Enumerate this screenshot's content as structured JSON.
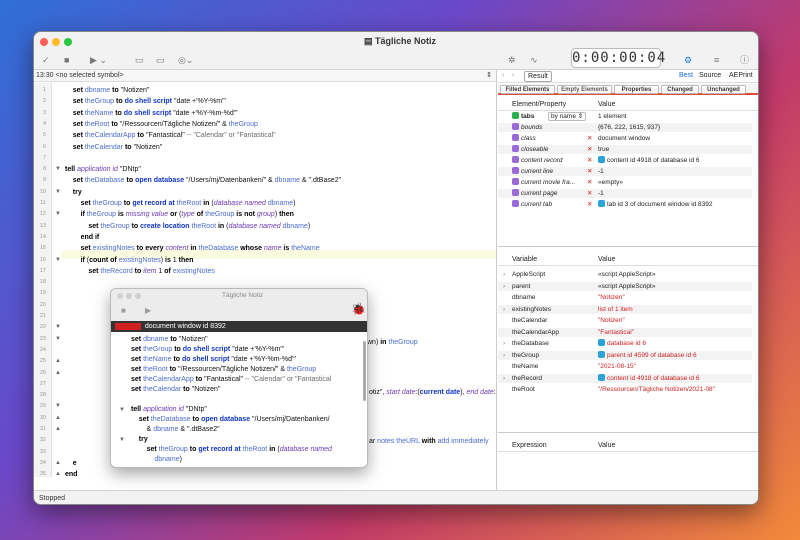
{
  "window": {
    "title": "Tägliche Notiz",
    "timer": "0:00:00:04"
  },
  "toolbar_right": {
    "best": "Best",
    "source": "Source",
    "aeprint": "AEPrint",
    "result_btn": "Result"
  },
  "navbar": {
    "position": "13:30",
    "symbol": "<no selected symbol>"
  },
  "status": "Stopped",
  "code_lines": [
    {
      "n": "1",
      "t": "    <span class='k'>set</span> <span class='c'>dbname</span> <span class='k'>to</span> \"Notizen\""
    },
    {
      "n": "2",
      "t": "    <span class='k'>set</span> <span class='c'>theGroup</span> <span class='k'>to</span> <span class='b'>do shell script</span> \"date +'%Y-%m'\""
    },
    {
      "n": "3",
      "t": "    <span class='k'>set</span> <span class='c'>theName</span> <span class='k'>to</span> <span class='b'>do shell script</span> \"date +'%Y-%m-%d'\""
    },
    {
      "n": "4",
      "t": "    <span class='k'>set</span> <span class='c'>theRoot</span> <span class='k'>to</span> \"/Ressourcen/Tägliche Notizen/\" &amp; <span class='c'>theGroup</span>"
    },
    {
      "n": "5",
      "t": "    <span class='k'>set</span> <span class='c'>theCalendarApp</span> <span class='k'>to</span> \"Fantastical\" <span class='g'>-- \"Calendar\" or \"Fantastical\"</span>"
    },
    {
      "n": "6",
      "t": "    <span class='k'>set</span> <span class='c'>theCalendar</span> <span class='k'>to</span> \"Notizen\""
    },
    {
      "n": "7",
      "t": ""
    },
    {
      "n": "8",
      "t": "<span class='k'>tell</span> <span class='i'>application id</span> \"DNtp\""
    },
    {
      "n": "9",
      "t": "    <span class='k'>set</span> <span class='c'>theDatabase</span> <span class='k'>to</span> <span class='b'>open database</span> \"/Users/mj/Datenbanken/\" &amp; <span class='c'>dbname</span> &amp; \".dtBase2\""
    },
    {
      "n": "10",
      "t": "    <span class='k'>try</span>"
    },
    {
      "n": "11",
      "t": "        <span class='k'>set</span> <span class='c'>theGroup</span> <span class='k'>to</span> <span class='b'>get record at</span> <span class='c'>theRoot</span> <span class='k'>in</span> (<span class='i'>database named</span> <span class='c'>dbname</span>)"
    },
    {
      "n": "12",
      "t": "        <span class='k'>if</span> <span class='c'>theGroup</span> <span class='k'>is</span> <span class='i'>missing value</span> <span class='k'>or</span> (<span class='i'>type</span> <span class='k'>of</span> <span class='c'>theGroup</span> <span class='k'>is not</span> <span class='i'>group</span>) <span class='k'>then</span>"
    },
    {
      "n": "13",
      "t": "            <span class='k'>set</span> <span class='c'>theGroup</span> <span class='k'>to</span> <span class='b'>create location</span> <span class='c'>theRoot</span> <span class='k'>in</span> (<span class='i'>database named</span> <span class='c'>dbname</span>)"
    },
    {
      "n": "14",
      "t": "        <span class='k'>end if</span>"
    },
    {
      "n": "15",
      "t": "        <span class='k'>set</span> <span class='c'>existingNotes</span> <span class='k'>to</span> <span class='k'>every</span> <span class='i'>content</span> <span class='k'>in</span> <span class='c'>theDatabase</span> <span class='k'>whose</span> <span class='i'>name</span> <span class='k'>is</span> <span class='c'>theName</span>"
    },
    {
      "n": "16",
      "t": "        <span class='k'>if</span> (<span class='k'>count of</span> <span class='c'>existingNotes</span>) <span class='k'>is</span> 1 <span class='k'>then</span>"
    },
    {
      "n": "17",
      "t": "            <span class='k'>set</span> <span class='c'>theRecord</span> <span class='k'>to</span> <span class='i'>item</span> 1 <span class='k'>of</span> <span class='c'>existingNotes</span>"
    },
    {
      "n": "18",
      "t": ""
    },
    {
      "n": "19",
      "t": ""
    },
    {
      "n": "20",
      "t": ""
    },
    {
      "n": "21",
      "t": ""
    },
    {
      "n": "22",
      "t": ""
    },
    {
      "n": "23",
      "t": ""
    },
    {
      "n": "24",
      "t": ""
    },
    {
      "n": "25",
      "t": ""
    },
    {
      "n": "26",
      "t": ""
    },
    {
      "n": "27",
      "t": ""
    },
    {
      "n": "28",
      "t": ""
    },
    {
      "n": "29",
      "t": ""
    },
    {
      "n": "30",
      "t": ""
    },
    {
      "n": "31",
      "t": ""
    },
    {
      "n": "32",
      "t": ""
    },
    {
      "n": "33",
      "t": ""
    },
    {
      "n": "34",
      "t": "    <span class='k'>e</span>"
    },
    {
      "n": "35",
      "t": "<span class='k'>end</span>"
    }
  ],
  "behind_fragments": {
    "a": "wn) <span class='k'>in</span> <span class='c'>theGroup</span>",
    "b": "otiz\", <span class='i'>start date</span>:(<span class='b'>current date</span>), <span class='i'>end date</span>:(",
    "c": "ar <span class='c'>notes</span> <span class='c'>theURL</span> <span class='k'>with</span> <span class='c'>add immediately</span>"
  },
  "debugger": {
    "title": "Tägliche Notiz",
    "bar_label": "document window id 8392",
    "bar_red": "Result",
    "lines": [
      "<span class='k'>set</span> <span class='c'>dbname</span> <span class='k'>to</span> \"Notizen\"",
      "<span class='k'>set</span> <span class='c'>theGroup</span> <span class='k'>to</span> <span class='b'>do shell script</span> \"date +'%Y-%m'\"",
      "<span class='k'>set</span> <span class='c'>theName</span> <span class='k'>to</span> <span class='b'>do shell script</span> \"date +'%Y-%m-%d'\"",
      "<span class='k'>set</span> <span class='c'>theRoot</span> <span class='k'>to</span> \"/Ressourcen/Tägliche Notizen/\" &amp; <span class='c'>theGroup</span>",
      "<span class='k'>set</span> <span class='c'>theCalendarApp</span> <span class='k'>to</span> \"Fantastical\" <span class='g'>-- \"Calendar\" or \"Fantastical</span>",
      "<span class='k'>set</span> <span class='c'>theCalendar</span> <span class='k'>to</span> \"Notizen\"",
      "",
      "<span class='k'>tell</span> <span class='i'>application id</span> \"DNtp\"",
      "    <span class='k'>set</span> <span class='c'>theDatabase</span> <span class='k'>to</span> <span class='b'>open database</span> \"/Users/mj/Datenbanken/",
      "        &amp; <span class='c'>dbname</span> &amp; \".dtBase2\"",
      "    <span class='k'>try</span>",
      "        <span class='k'>set</span> <span class='c'>theGroup</span> <span class='k'>to</span> <span class='b'>get record at</span> <span class='c'>theRoot</span> <span class='k'>in</span> (<span class='i'>database named</span>",
      "            <span class='c'>dbname</span>)"
    ]
  },
  "tabs": [
    "Filled Elements",
    "Empty Elements",
    "Properties",
    "Changed",
    "Unchanged"
  ],
  "elements_header": {
    "key": "Element/Property",
    "value": "Value"
  },
  "elements": [
    {
      "k": "tabs",
      "v": "1 element",
      "extra": "by name"
    },
    {
      "k": "bounds",
      "v": "{676, 222, 1615, 937}"
    },
    {
      "k": "class",
      "v": "document window"
    },
    {
      "k": "closeable",
      "v": "true"
    },
    {
      "k": "content record",
      "v": "content id 4918 of database id 6"
    },
    {
      "k": "current line",
      "v": "-1"
    },
    {
      "k": "current movie fra...",
      "v": "«empty»"
    },
    {
      "k": "current page",
      "v": "-1"
    },
    {
      "k": "current tab",
      "v": "tab id 3 of document window id 8392"
    }
  ],
  "variables_header": {
    "key": "Variable",
    "value": "Value"
  },
  "variables": [
    {
      "k": "AppleScript",
      "v": "«script AppleScript»"
    },
    {
      "k": "parent",
      "v": "«script AppleScript»"
    },
    {
      "k": "dbname",
      "v": "\"Notizen\""
    },
    {
      "k": "existingNotes",
      "v": "list of 1 item"
    },
    {
      "k": "theCalendar",
      "v": "\"Notizen\""
    },
    {
      "k": "theCalendarApp",
      "v": "\"Fantastical\""
    },
    {
      "k": "theDatabase",
      "v": "database id 6"
    },
    {
      "k": "theGroup",
      "v": "parent id 4599 of database id 6"
    },
    {
      "k": "theName",
      "v": "\"2021-08-15\""
    },
    {
      "k": "theRecord",
      "v": "content id 4918 of database id 6"
    },
    {
      "k": "theRoot",
      "v": "\"/Ressourcen/Tägliche Notizen/2021-08\""
    }
  ],
  "expr_header": {
    "key": "Expression",
    "value": "Value"
  },
  "bottom": {
    "plus": "+",
    "minus": "−"
  }
}
